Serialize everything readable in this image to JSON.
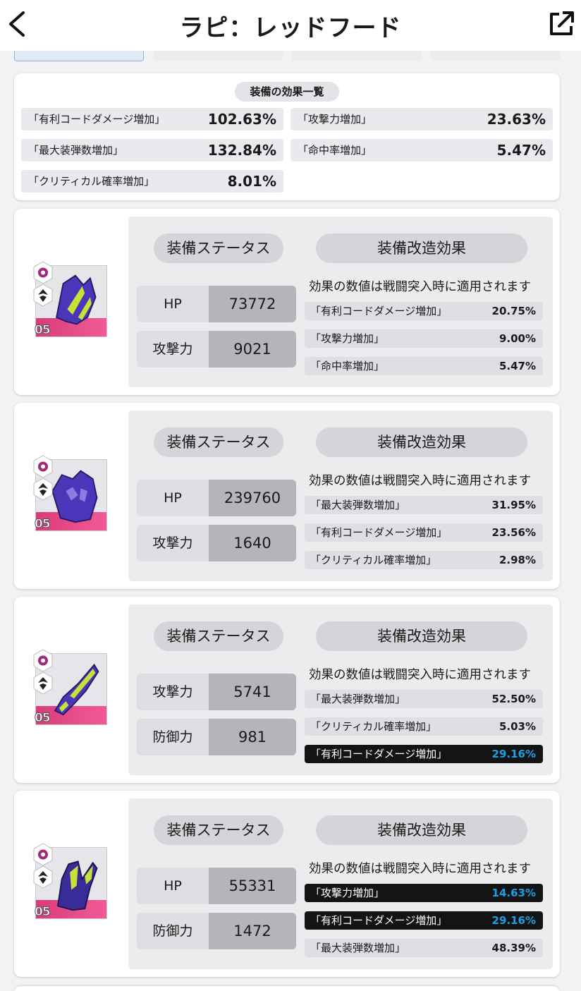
{
  "header": {
    "title": "ラピ：レッドフード"
  },
  "summary": {
    "title": "装備の効果一覧",
    "effects": [
      {
        "label": "「有利コードダメージ増加」",
        "value": "102.63%"
      },
      {
        "label": "「攻撃力増加」",
        "value": "23.63%"
      },
      {
        "label": "「最大装弾数増加」",
        "value": "132.84%"
      },
      {
        "label": "「命中率増加」",
        "value": "5.47%"
      },
      {
        "label": "「クリティカル確率増加」",
        "value": "8.01%"
      }
    ]
  },
  "equipment": [
    {
      "level": "05",
      "status_label": "装備ステータス",
      "mod_label": "装備改造効果",
      "note": "効果の数値は戦闘突入時に適用されます",
      "stats": [
        {
          "label": "HP",
          "value": "73772"
        },
        {
          "label": "攻撃力",
          "value": "9021"
        }
      ],
      "mods": [
        {
          "label": "「有利コードダメージ増加」",
          "value": "20.75%",
          "highlight": false
        },
        {
          "label": "「攻撃力増加」",
          "value": "9.00%",
          "highlight": false
        },
        {
          "label": "「命中率増加」",
          "value": "5.47%",
          "highlight": false
        }
      ]
    },
    {
      "level": "05",
      "status_label": "装備ステータス",
      "mod_label": "装備改造効果",
      "note": "効果の数値は戦闘突入時に適用されます",
      "stats": [
        {
          "label": "HP",
          "value": "239760"
        },
        {
          "label": "攻撃力",
          "value": "1640"
        }
      ],
      "mods": [
        {
          "label": "「最大装弾数増加」",
          "value": "31.95%",
          "highlight": false
        },
        {
          "label": "「有利コードダメージ増加」",
          "value": "23.56%",
          "highlight": false
        },
        {
          "label": "「クリティカル確率増加」",
          "value": "2.98%",
          "highlight": false
        }
      ]
    },
    {
      "level": "05",
      "status_label": "装備ステータス",
      "mod_label": "装備改造効果",
      "note": "効果の数値は戦闘突入時に適用されます",
      "stats": [
        {
          "label": "攻撃力",
          "value": "5741"
        },
        {
          "label": "防御力",
          "value": "981"
        }
      ],
      "mods": [
        {
          "label": "「最大装弾数増加」",
          "value": "52.50%",
          "highlight": false
        },
        {
          "label": "「クリティカル確率増加」",
          "value": "5.03%",
          "highlight": false
        },
        {
          "label": "「有利コードダメージ増加」",
          "value": "29.16%",
          "highlight": true
        }
      ]
    },
    {
      "level": "05",
      "status_label": "装備ステータス",
      "mod_label": "装備改造効果",
      "note": "効果の数値は戦闘突入時に適用されます",
      "stats": [
        {
          "label": "HP",
          "value": "55331"
        },
        {
          "label": "防御力",
          "value": "1472"
        }
      ],
      "mods": [
        {
          "label": "「攻撃力増加」",
          "value": "14.63%",
          "highlight": true
        },
        {
          "label": "「有利コードダメージ増加」",
          "value": "29.16%",
          "highlight": true
        },
        {
          "label": "「最大装弾数増加」",
          "value": "48.39%",
          "highlight": false
        }
      ]
    }
  ],
  "colors": {
    "highlight_bg": "#141414",
    "highlight_value": "#1aa0e6",
    "level_bar": "#e84a88",
    "armor_purple": "#4a36b8",
    "armor_lime": "#c8e03a"
  },
  "icons": [
    "back-chevron-icon",
    "external-link-icon",
    "manufacturer-hex-icon",
    "class-hex-icon"
  ]
}
